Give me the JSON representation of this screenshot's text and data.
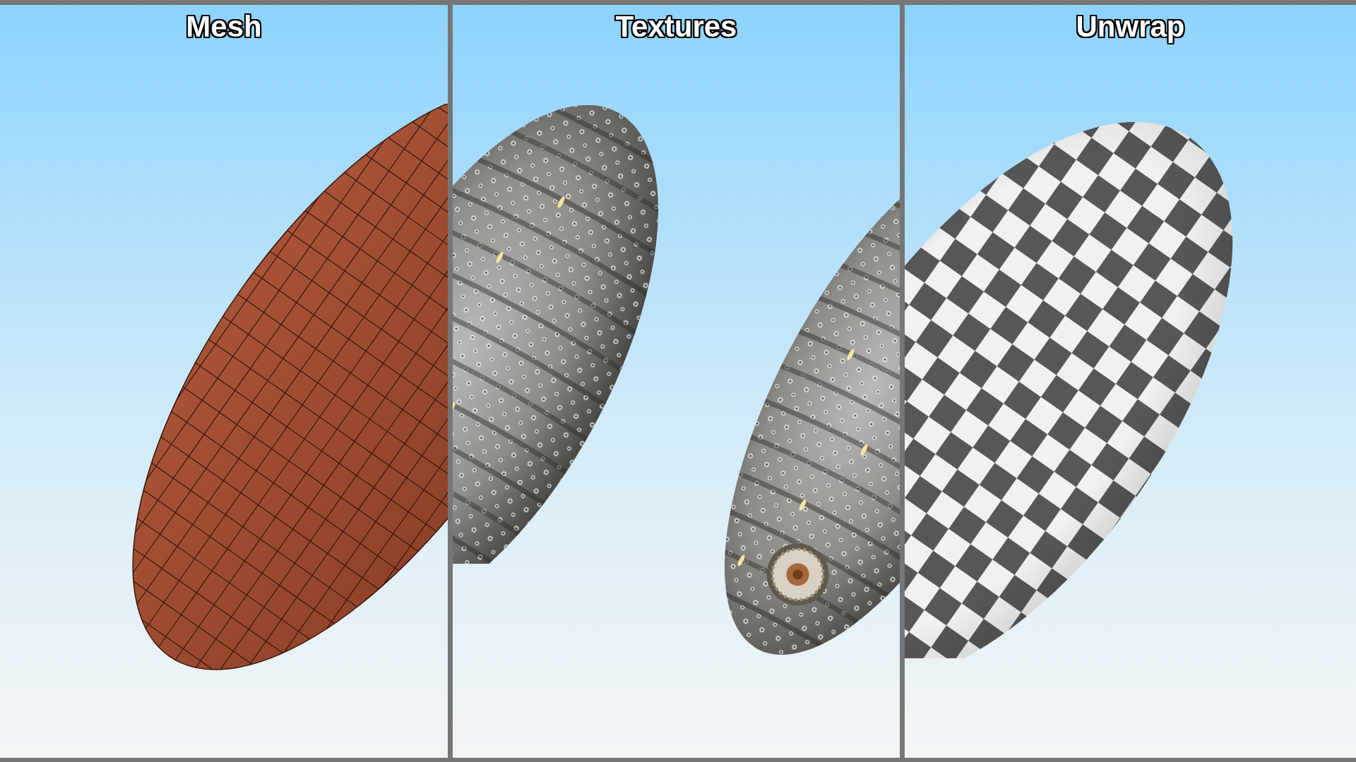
{
  "panels": [
    {
      "title": "Mesh",
      "kind": "mesh"
    },
    {
      "title": "Textures",
      "kind": "textures"
    },
    {
      "title": "Unwrap",
      "kind": "unwrap"
    }
  ]
}
